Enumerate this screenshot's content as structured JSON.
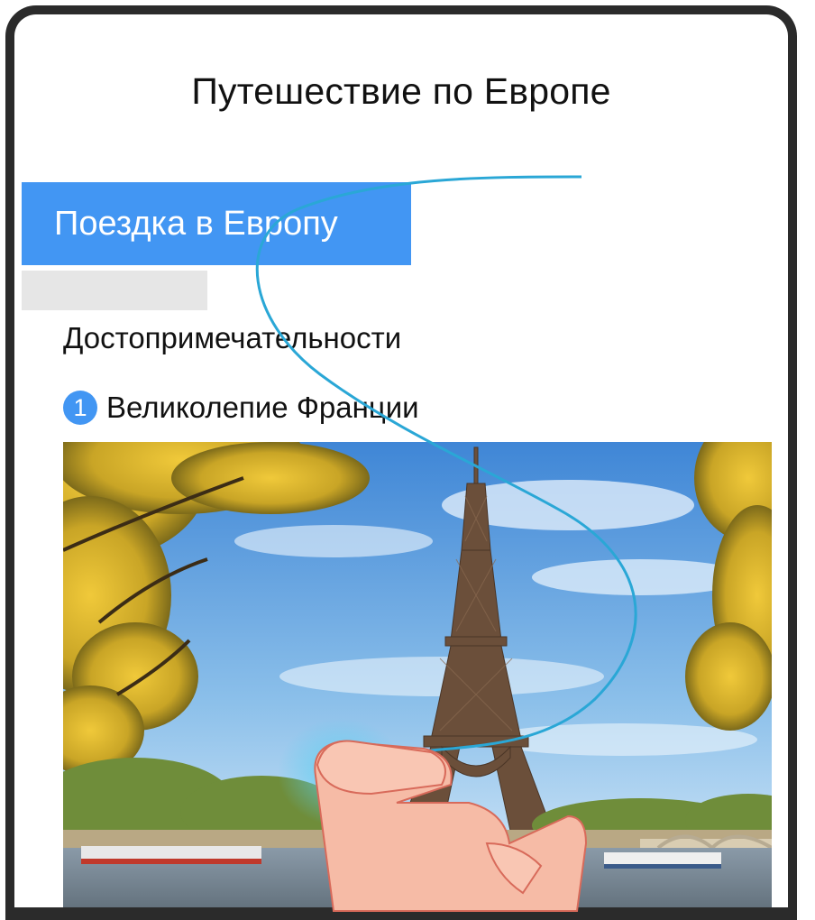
{
  "header": {
    "title": "Путешествие по Европе"
  },
  "tab": {
    "label": "Поездка в Европу"
  },
  "section": {
    "heading": "Достопримечательности"
  },
  "list": [
    {
      "number": "1",
      "label": "Великолепие Франции"
    }
  ],
  "colors": {
    "accent": "#4296f3",
    "gesture_line": "#2aa7d6",
    "frame": "#2b2b2b"
  },
  "icons": {
    "badge": "number-badge-icon",
    "gesture": "hand-gesture-icon"
  }
}
